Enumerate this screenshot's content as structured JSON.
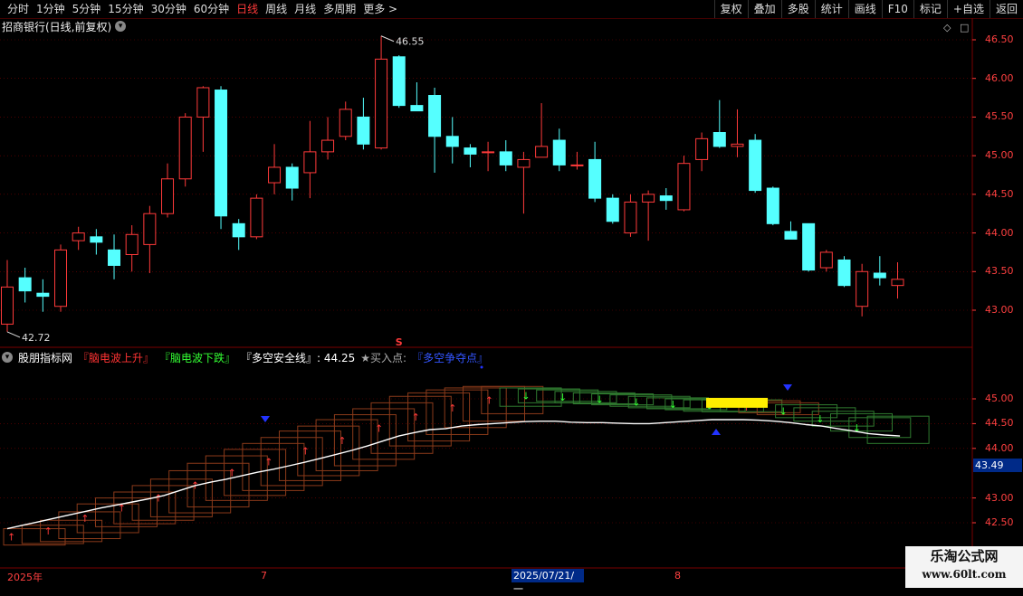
{
  "toolbar": {
    "periods": [
      "分时",
      "1分钟",
      "5分钟",
      "15分钟",
      "30分钟",
      "60分钟",
      "日线",
      "周线",
      "月线",
      "多周期",
      "更多 >"
    ],
    "active_index": 6,
    "right_buttons": [
      "复权",
      "叠加",
      "多股",
      "统计",
      "画线",
      "F10",
      "标记",
      "+自选",
      "返回"
    ]
  },
  "main": {
    "title": "招商银行(日线,前复权)",
    "high_label": "46.55",
    "low_label": "42.72",
    "signal_mark": "S",
    "axis_ticks": [
      "46.50",
      "46.00",
      "45.50",
      "45.00",
      "44.50",
      "44.00",
      "43.50",
      "43.00"
    ]
  },
  "indicator": {
    "name": "股朋指标网",
    "rise": "『脑电波上升』",
    "fall": "『脑电波下跌』",
    "safe_line": "『多空安全线』: 44.25",
    "buy": "★买入点:",
    "contest": "『多空争夺点』",
    "axis_ticks": [
      "45.00",
      "44.50",
      "44.00",
      "43.00",
      "42.50"
    ],
    "price_tag": "43.49"
  },
  "dates": {
    "year": "2025年",
    "m7": "7",
    "highlight": "2025/07/21/一",
    "m8": "8"
  },
  "watermark": {
    "line1": "乐淘公式网",
    "line2": "www.60lt.com"
  },
  "colors": {
    "up": "#ff3a3a",
    "down": "#55ffff",
    "grid": "#7a0000"
  },
  "chart_data": {
    "type": "candlestick",
    "title": "招商银行(日线,前复权)",
    "ylim": [
      42.6,
      46.8
    ],
    "candles": [
      {
        "o": 42.82,
        "c": 43.3,
        "h": 43.65,
        "l": 42.72
      },
      {
        "o": 43.42,
        "c": 43.25,
        "h": 43.55,
        "l": 43.1
      },
      {
        "o": 43.22,
        "c": 43.18,
        "h": 43.4,
        "l": 42.98
      },
      {
        "o": 43.05,
        "c": 43.78,
        "h": 43.85,
        "l": 42.98
      },
      {
        "o": 43.9,
        "c": 44.0,
        "h": 44.08,
        "l": 43.78
      },
      {
        "o": 43.95,
        "c": 43.88,
        "h": 44.05,
        "l": 43.72
      },
      {
        "o": 43.78,
        "c": 43.58,
        "h": 43.98,
        "l": 43.4
      },
      {
        "o": 43.72,
        "c": 43.98,
        "h": 44.1,
        "l": 43.5
      },
      {
        "o": 43.85,
        "c": 44.25,
        "h": 44.35,
        "l": 43.48
      },
      {
        "o": 44.25,
        "c": 44.7,
        "h": 44.9,
        "l": 44.2
      },
      {
        "o": 44.7,
        "c": 45.5,
        "h": 45.55,
        "l": 44.6
      },
      {
        "o": 45.5,
        "c": 45.88,
        "h": 45.9,
        "l": 45.05
      },
      {
        "o": 45.85,
        "c": 44.22,
        "h": 45.9,
        "l": 44.05
      },
      {
        "o": 44.12,
        "c": 43.95,
        "h": 44.18,
        "l": 43.78
      },
      {
        "o": 43.95,
        "c": 44.45,
        "h": 44.5,
        "l": 43.92
      },
      {
        "o": 44.65,
        "c": 44.85,
        "h": 45.15,
        "l": 44.5
      },
      {
        "o": 44.85,
        "c": 44.58,
        "h": 44.9,
        "l": 44.42
      },
      {
        "o": 44.78,
        "c": 45.05,
        "h": 45.45,
        "l": 44.45
      },
      {
        "o": 45.05,
        "c": 45.2,
        "h": 45.5,
        "l": 44.95
      },
      {
        "o": 45.25,
        "c": 45.6,
        "h": 45.7,
        "l": 45.2
      },
      {
        "o": 45.5,
        "c": 45.15,
        "h": 45.75,
        "l": 45.08
      },
      {
        "o": 45.1,
        "c": 46.25,
        "h": 46.55,
        "l": 45.08
      },
      {
        "o": 46.28,
        "c": 45.65,
        "h": 46.3,
        "l": 45.62
      },
      {
        "o": 45.65,
        "c": 45.58,
        "h": 45.95,
        "l": 45.58
      },
      {
        "o": 45.78,
        "c": 45.25,
        "h": 45.88,
        "l": 44.78
      },
      {
        "o": 45.25,
        "c": 45.12,
        "h": 45.5,
        "l": 44.9
      },
      {
        "o": 45.1,
        "c": 45.02,
        "h": 45.15,
        "l": 44.85
      },
      {
        "o": 45.05,
        "c": 45.05,
        "h": 45.18,
        "l": 44.8
      },
      {
        "o": 45.05,
        "c": 44.88,
        "h": 45.2,
        "l": 44.8
      },
      {
        "o": 44.85,
        "c": 44.95,
        "h": 45.05,
        "l": 44.25
      },
      {
        "o": 44.98,
        "c": 45.12,
        "h": 45.68,
        "l": 44.98
      },
      {
        "o": 45.2,
        "c": 44.88,
        "h": 45.35,
        "l": 44.8
      },
      {
        "o": 44.88,
        "c": 44.88,
        "h": 45.05,
        "l": 44.82
      },
      {
        "o": 44.95,
        "c": 44.45,
        "h": 45.18,
        "l": 44.4
      },
      {
        "o": 44.45,
        "c": 44.15,
        "h": 44.5,
        "l": 44.12
      },
      {
        "o": 44.0,
        "c": 44.4,
        "h": 44.5,
        "l": 43.95
      },
      {
        "o": 44.4,
        "c": 44.5,
        "h": 44.55,
        "l": 43.9
      },
      {
        "o": 44.48,
        "c": 44.42,
        "h": 44.58,
        "l": 44.3
      },
      {
        "o": 44.3,
        "c": 44.9,
        "h": 45.0,
        "l": 44.28
      },
      {
        "o": 44.95,
        "c": 45.22,
        "h": 45.3,
        "l": 44.8
      },
      {
        "o": 45.3,
        "c": 45.12,
        "h": 45.72,
        "l": 45.1
      },
      {
        "o": 45.12,
        "c": 45.15,
        "h": 45.6,
        "l": 44.98
      },
      {
        "o": 45.2,
        "c": 44.55,
        "h": 45.28,
        "l": 44.52
      },
      {
        "o": 44.58,
        "c": 44.12,
        "h": 44.6,
        "l": 44.1
      },
      {
        "o": 44.02,
        "c": 43.92,
        "h": 44.15,
        "l": 43.92
      },
      {
        "o": 44.12,
        "c": 43.52,
        "h": 44.12,
        "l": 43.5
      },
      {
        "o": 43.55,
        "c": 43.75,
        "h": 43.78,
        "l": 43.5
      },
      {
        "o": 43.65,
        "c": 43.32,
        "h": 43.7,
        "l": 43.3
      },
      {
        "o": 43.05,
        "c": 43.5,
        "h": 43.6,
        "l": 42.92
      },
      {
        "o": 43.48,
        "c": 43.42,
        "h": 43.7,
        "l": 43.32
      },
      {
        "o": 43.32,
        "c": 43.4,
        "h": 43.62,
        "l": 43.15
      }
    ],
    "indicator": {
      "ylim": [
        42.2,
        45.8
      ],
      "safe_line": [
        42.38,
        42.45,
        42.52,
        42.59,
        42.66,
        42.73,
        42.8,
        42.86,
        42.92,
        42.98,
        43.05,
        43.15,
        43.25,
        43.32,
        43.38,
        43.45,
        43.52,
        43.58,
        43.65,
        43.72,
        43.8,
        43.88,
        43.96,
        44.05,
        44.15,
        44.25,
        44.32,
        44.38,
        44.4,
        44.45,
        44.48,
        44.5,
        44.52,
        44.54,
        44.55,
        44.55,
        44.53,
        44.52,
        44.52,
        44.51,
        44.5,
        44.5,
        44.52,
        44.54,
        44.56,
        44.58,
        44.58,
        44.58,
        44.57,
        44.55,
        44.52,
        44.48,
        44.45,
        44.4,
        44.35,
        44.3,
        44.27,
        44.25
      ],
      "boxes": [
        {
          "lo": 42.05,
          "hi": 42.38,
          "t": "u"
        },
        {
          "lo": 42.08,
          "hi": 42.45,
          "t": "u"
        },
        {
          "lo": 42.12,
          "hi": 42.55,
          "t": "u"
        },
        {
          "lo": 42.18,
          "hi": 42.72,
          "t": "u"
        },
        {
          "lo": 42.3,
          "hi": 42.88,
          "t": "u"
        },
        {
          "lo": 42.42,
          "hi": 43.0,
          "t": "u"
        },
        {
          "lo": 42.48,
          "hi": 43.12,
          "t": "u"
        },
        {
          "lo": 42.55,
          "hi": 43.25,
          "t": "u"
        },
        {
          "lo": 42.62,
          "hi": 43.38,
          "t": "u"
        },
        {
          "lo": 42.7,
          "hi": 43.55,
          "t": "u"
        },
        {
          "lo": 42.82,
          "hi": 43.7,
          "t": "u"
        },
        {
          "lo": 42.95,
          "hi": 43.85,
          "t": "u"
        },
        {
          "lo": 43.05,
          "hi": 43.98,
          "t": "u"
        },
        {
          "lo": 43.15,
          "hi": 44.1,
          "t": "u"
        },
        {
          "lo": 43.25,
          "hi": 44.22,
          "t": "u"
        },
        {
          "lo": 43.35,
          "hi": 44.35,
          "t": "u"
        },
        {
          "lo": 43.45,
          "hi": 44.45,
          "t": "u"
        },
        {
          "lo": 43.55,
          "hi": 44.58,
          "t": "u"
        },
        {
          "lo": 43.65,
          "hi": 44.68,
          "t": "u"
        },
        {
          "lo": 43.78,
          "hi": 44.8,
          "t": "u"
        },
        {
          "lo": 43.9,
          "hi": 44.92,
          "t": "u"
        },
        {
          "lo": 44.05,
          "hi": 45.05,
          "t": "u"
        },
        {
          "lo": 44.15,
          "hi": 45.12,
          "t": "u"
        },
        {
          "lo": 44.28,
          "hi": 45.18,
          "t": "u"
        },
        {
          "lo": 44.42,
          "hi": 45.22,
          "t": "u"
        },
        {
          "lo": 44.55,
          "hi": 45.25,
          "t": "u"
        },
        {
          "lo": 44.7,
          "hi": 45.25,
          "t": "u"
        },
        {
          "lo": 44.85,
          "hi": 45.22,
          "t": "d"
        },
        {
          "lo": 44.92,
          "hi": 45.2,
          "t": "d"
        },
        {
          "lo": 44.95,
          "hi": 45.18,
          "t": "d"
        },
        {
          "lo": 44.92,
          "hi": 45.15,
          "t": "d"
        },
        {
          "lo": 44.9,
          "hi": 45.12,
          "t": "d"
        },
        {
          "lo": 44.88,
          "hi": 45.1,
          "t": "d"
        },
        {
          "lo": 44.85,
          "hi": 45.08,
          "t": "d"
        },
        {
          "lo": 44.82,
          "hi": 45.05,
          "t": "d"
        },
        {
          "lo": 44.8,
          "hi": 45.02,
          "t": "d"
        },
        {
          "lo": 44.78,
          "hi": 45.0,
          "t": "d"
        },
        {
          "lo": 44.75,
          "hi": 44.98,
          "t": "d"
        },
        {
          "lo": 44.74,
          "hi": 44.98,
          "t": "d"
        },
        {
          "lo": 44.74,
          "hi": 44.98,
          "t": "d"
        },
        {
          "lo": 44.72,
          "hi": 44.96,
          "t": "u"
        },
        {
          "lo": 44.68,
          "hi": 44.92,
          "t": "u"
        },
        {
          "lo": 44.62,
          "hi": 44.88,
          "t": "d"
        },
        {
          "lo": 44.55,
          "hi": 44.82,
          "t": "d"
        },
        {
          "lo": 44.45,
          "hi": 44.75,
          "t": "d"
        },
        {
          "lo": 44.35,
          "hi": 44.7,
          "t": "d"
        },
        {
          "lo": 44.22,
          "hi": 44.62,
          "t": "d"
        },
        {
          "lo": 44.1,
          "hi": 44.65,
          "t": "d"
        }
      ],
      "box_start": 1,
      "buy_points": [
        14,
        39
      ],
      "sell_points": [
        14,
        43
      ],
      "yellow": {
        "from": 39,
        "to": 42,
        "lo": 44.82,
        "hi": 45.02
      }
    }
  }
}
